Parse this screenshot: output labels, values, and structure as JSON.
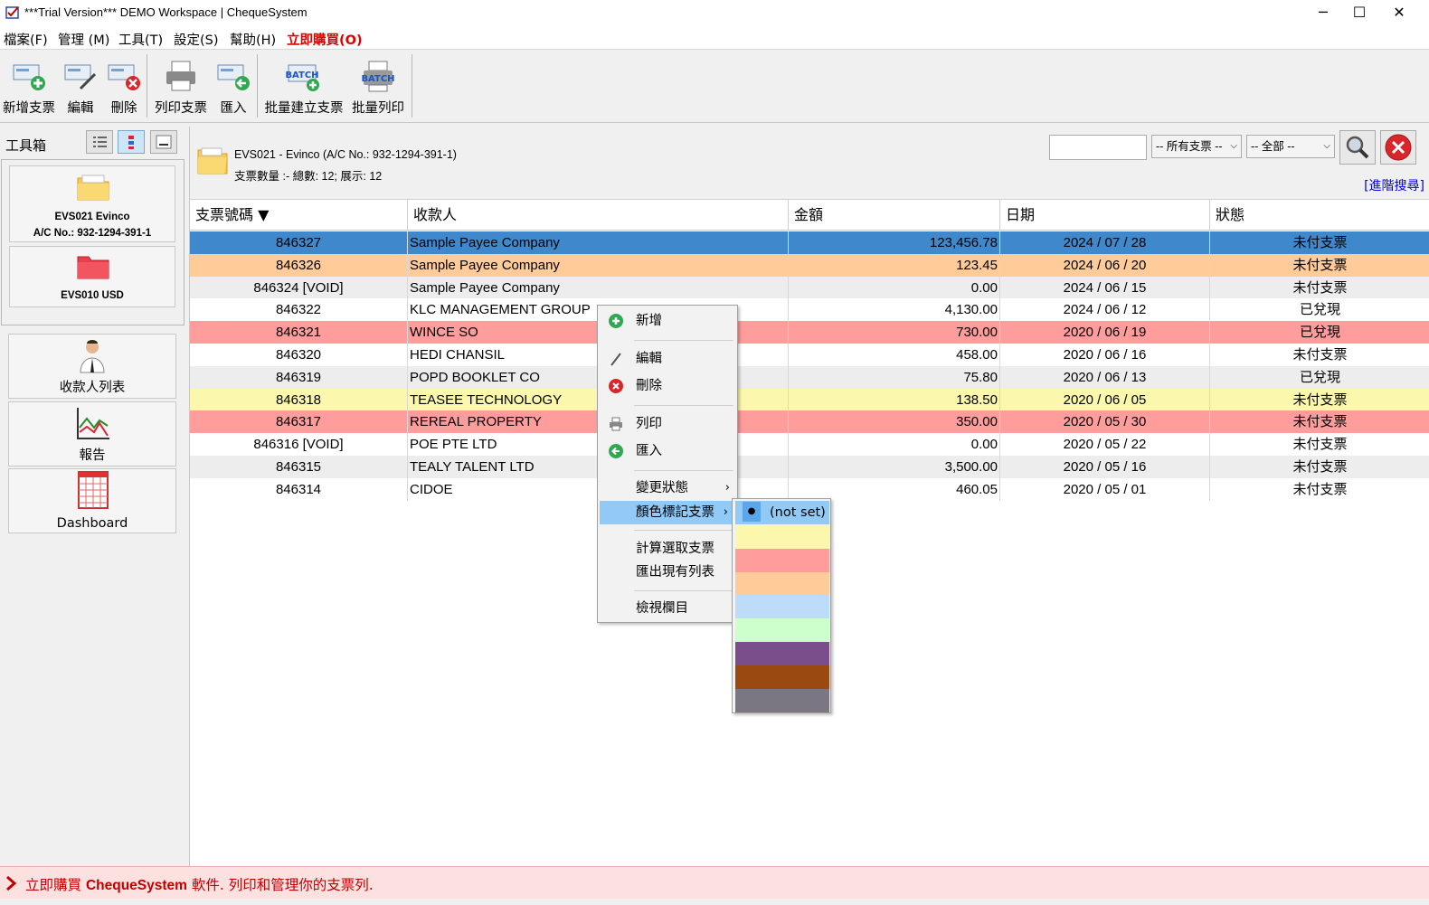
{
  "window": {
    "title": "***Trial Version*** DEMO Workspace | ChequeSystem",
    "minimize": "─",
    "maximize": "☐",
    "close": "✕"
  },
  "menu": [
    {
      "label": "檔案(F)"
    },
    {
      "label": "管理 (M)"
    },
    {
      "label": "工具(T)"
    },
    {
      "label": "設定(S)"
    },
    {
      "label": "幫助(H)"
    },
    {
      "label": "立即購買(O)",
      "color": "#e00000"
    }
  ],
  "toolbar": {
    "new_cheque": "新增支票",
    "edit": "編輯",
    "delete": "刪除",
    "print_cheque": "列印支票",
    "import": "匯入",
    "batch_create": "批量建立支票",
    "batch_print": "批量列印",
    "batch_badge": "BATCH"
  },
  "sidebar": {
    "title": "工具箱",
    "accounts": [
      {
        "name": "EVS021 Evinco",
        "sub": "A/C No.: 932-1294-391-1"
      },
      {
        "name": "EVS010 USD",
        "sub": ""
      }
    ],
    "nav": [
      {
        "label": "收款人列表"
      },
      {
        "label": "報告"
      },
      {
        "label": "Dashboard"
      }
    ]
  },
  "account_header": {
    "line1": "EVS021 - Evinco (A/C No.: 932-1294-391-1)",
    "line2": "支票數量 :- 總數: 12; 展示: 12"
  },
  "search": {
    "value": "",
    "filter1": "-- 所有支票 --",
    "filter2": "-- 全部 --",
    "advanced": "[進階搜尋]"
  },
  "columns": [
    "支票號碼 ▼",
    "收款人",
    "金額",
    "日期",
    "狀態"
  ],
  "rows": [
    {
      "no": "846327",
      "payee": "Sample Payee Company",
      "amount": "123,456.78",
      "date": "2024 / 07 / 28",
      "status": "未付支票",
      "bg": "#3f88cc",
      "fg": "#000"
    },
    {
      "no": "846326",
      "payee": "Sample Payee Company",
      "amount": "123.45",
      "date": "2024 / 06 / 20",
      "status": "未付支票",
      "bg": "#ffcb99",
      "fg": "#000"
    },
    {
      "no": "846324 [VOID]",
      "payee": "Sample Payee Company",
      "amount": "0.00",
      "date": "2024 / 06 / 15",
      "status": "未付支票",
      "bg": "#ededed",
      "fg": "#000"
    },
    {
      "no": "846322",
      "payee": "KLC MANAGEMENT GROUP",
      "amount": "4,130.00",
      "date": "2024 / 06 / 12",
      "status": "已兌現",
      "bg": "#ffffff",
      "fg": "#000"
    },
    {
      "no": "846321",
      "payee": "WINCE SO",
      "amount": "730.00",
      "date": "2020 / 06 / 19",
      "status": "已兌現",
      "bg": "#ff9d9d",
      "fg": "#000"
    },
    {
      "no": "846320",
      "payee": "HEDI CHANSIL",
      "amount": "458.00",
      "date": "2020 / 06 / 16",
      "status": "未付支票",
      "bg": "#ffffff",
      "fg": "#000"
    },
    {
      "no": "846319",
      "payee": "POPD BOOKLET CO",
      "amount": "75.80",
      "date": "2020 / 06 / 13",
      "status": "已兌現",
      "bg": "#ededed",
      "fg": "#000"
    },
    {
      "no": "846318",
      "payee": "TEASEE TECHNOLOGY",
      "amount": "138.50",
      "date": "2020 / 06 / 05",
      "status": "未付支票",
      "bg": "#fbf8ad",
      "fg": "#000"
    },
    {
      "no": "846317",
      "payee": "REREAL PROPERTY",
      "amount": "350.00",
      "date": "2020 / 05 / 30",
      "status": "未付支票",
      "bg": "#ff9d9d",
      "fg": "#000"
    },
    {
      "no": "846316 [VOID]",
      "payee": "POE PTE LTD",
      "amount": "0.00",
      "date": "2020 / 05 / 22",
      "status": "未付支票",
      "bg": "#ffffff",
      "fg": "#000"
    },
    {
      "no": "846315",
      "payee": "TEALY TALENT LTD",
      "amount": "3,500.00",
      "date": "2020 / 05 / 16",
      "status": "未付支票",
      "bg": "#ededed",
      "fg": "#000"
    },
    {
      "no": "846314",
      "payee": "CIDOE",
      "amount": "460.05",
      "date": "2020 / 05 / 01",
      "status": "未付支票",
      "bg": "#ffffff",
      "fg": "#000"
    }
  ],
  "context_menu": {
    "add": "新增",
    "edit": "編輯",
    "delete": "刪除",
    "print": "列印",
    "import": "匯入",
    "change_status": "變更狀態",
    "color_mark": "顏色標記支票",
    "calc_selected": "計算選取支票",
    "export_list": "匯出現有列表",
    "view_columns": "檢視欄目",
    "submenu_arrow": "›"
  },
  "color_submenu": {
    "not_set": "(not set)",
    "bullet": "●",
    "swatches": [
      "#fbf8ad",
      "#ff9d9d",
      "#ffcb99",
      "#bcdcfa",
      "#ccffcc",
      "#7a4e8a",
      "#9a4a10",
      "#7a7682"
    ]
  },
  "status_bar": {
    "prefix": "立即購買 ",
    "brand": "ChequeSystem",
    "suffix": " 軟件. 列印和管理你的支票列.",
    "color": "#c00000"
  }
}
